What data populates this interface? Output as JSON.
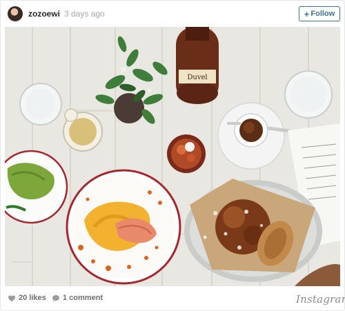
{
  "header": {
    "username": "zozoewi",
    "separator": "•",
    "timestamp": "3 days ago",
    "follow_label": "Follow",
    "follow_icon": "+"
  },
  "photo": {
    "subject": "overhead-brunch-table",
    "bottle_label": "Duvel",
    "accent_color": "#f2b230"
  },
  "footer": {
    "likes_text": "20 likes",
    "comments_text": "1 comment",
    "brand": "Instagram"
  },
  "colors": {
    "follow_blue": "#3f729b",
    "muted_text": "#6e6e6e",
    "plate_rim": "#a6262e"
  }
}
